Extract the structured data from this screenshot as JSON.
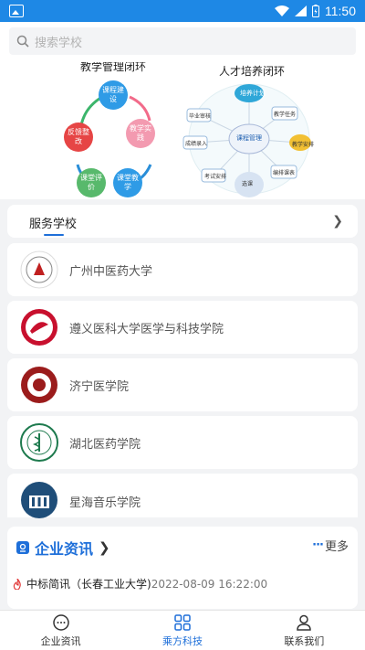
{
  "status_bar": {
    "time": "11:50"
  },
  "search": {
    "placeholder": "搜索学校"
  },
  "banner": {
    "left_title": "教学管理闭环",
    "right_title": "人才培养闭环",
    "cycle_nodes": [
      "课程建设",
      "教学实践",
      "课堂教学",
      "课堂评价",
      "反馈整改"
    ],
    "center_node": "课程管理",
    "right_nodes": [
      "培养计划",
      "毕业审核",
      "教学任务",
      "教学安排",
      "编排课表",
      "选课",
      "考试安排",
      "成绩录入"
    ]
  },
  "schools_section": {
    "title": "服务学校",
    "items": [
      {
        "name": "广州中医药大学"
      },
      {
        "name": "遵义医科大学医学与科技学院"
      },
      {
        "name": "济宁医学院"
      },
      {
        "name": "湖北医药学院"
      },
      {
        "name": "星海音乐学院"
      }
    ]
  },
  "news": {
    "title": "企业资讯",
    "more_label": "更多",
    "items": [
      {
        "title": "中标简讯（长春工业大学)",
        "time": "2022-08-09 16:22:00"
      }
    ]
  },
  "tabs": [
    {
      "label": "企业资讯",
      "icon": "chat-icon",
      "active": false
    },
    {
      "label": "乘方科技",
      "icon": "grid-icon",
      "active": true
    },
    {
      "label": "联系我们",
      "icon": "person-icon",
      "active": false
    }
  ],
  "colors": {
    "accent": "#1e6fd9",
    "status_bar": "#1e88e5"
  }
}
